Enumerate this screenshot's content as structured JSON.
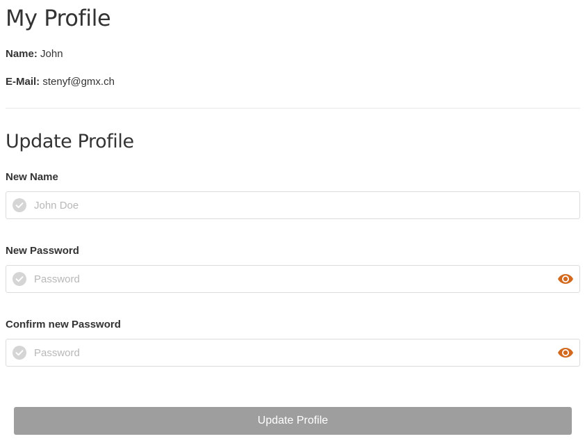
{
  "profile": {
    "title": "My Profile",
    "name_label": "Name:",
    "name_value": "John",
    "email_label": "E-Mail:",
    "email_value": "stenyf@gmx.ch"
  },
  "update": {
    "title": "Update Profile",
    "fields": [
      {
        "label": "New Name",
        "placeholder": "John Doe",
        "value": "",
        "icon": "check-circle-icon"
      },
      {
        "label": "New Password",
        "placeholder": "Password",
        "value": "",
        "icon": "check-circle-icon",
        "toggle_icon": "eye-icon"
      },
      {
        "label": "Confirm new Password",
        "placeholder": "Password",
        "value": "",
        "icon": "check-circle-icon",
        "toggle_icon": "eye-icon"
      }
    ],
    "submit_label": "Update Profile"
  },
  "colors": {
    "text": "#333333",
    "check_icon": "#d5d5d5",
    "eye_icon": "#d2691e",
    "button_bg": "#9e9e9e",
    "button_text": "#ffffff",
    "border": "#dcdcdc"
  }
}
